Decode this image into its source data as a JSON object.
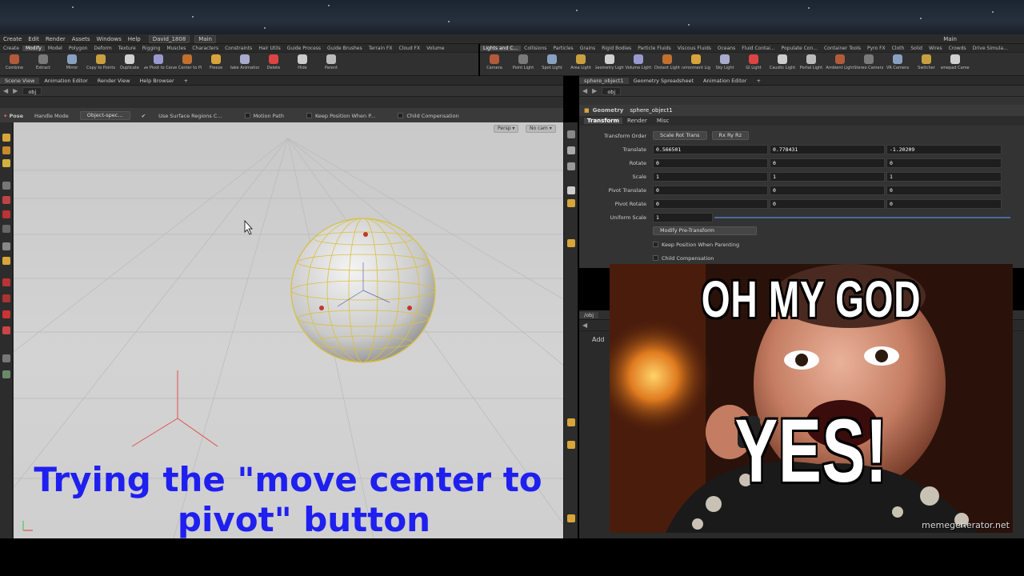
{
  "menubar": {
    "items": [
      "Create",
      "Edit",
      "Render",
      "Assets",
      "Windows",
      "Help"
    ],
    "desktop": "David_1808",
    "context": "Main",
    "right_label": "Main"
  },
  "shelf_left": {
    "tabs": [
      "Create",
      "Modify",
      "Model",
      "Polygon",
      "Deform",
      "Texture",
      "Rigging",
      "Muscles",
      "Characters",
      "Constraints",
      "Hair Utils",
      "Guide Process",
      "Guide Brushes",
      "Terrain FX",
      "Cloud FX",
      "Volume"
    ],
    "tools": [
      "Combine",
      "Extract",
      "Mirror",
      "Copy to Points",
      "Duplicate",
      "Move Pivot to Center",
      "Move Center to Pivot",
      "Freeze",
      "Bake Animation",
      "Delete",
      "Hide",
      "Parent"
    ]
  },
  "shelf_right": {
    "tabs": [
      "Lights and C...",
      "Collisions",
      "Particles",
      "Grains",
      "Rigid Bodies",
      "Particle Fluids",
      "Viscous Fluids",
      "Oceans",
      "Fluid Contai...",
      "Populate Con...",
      "Container Tools",
      "Pyro FX",
      "Cloth",
      "Solid",
      "Wires",
      "Crowds",
      "Drive Simula..."
    ],
    "tools": [
      "Camera",
      "Point Light",
      "Spot Light",
      "Area Light",
      "Geometry Light",
      "Volume Light",
      "Distant Light",
      "Environment Light",
      "Sky Light",
      "GI Light",
      "Caustic Light",
      "Portal Light",
      "Ambient Light",
      "Stereo Camera",
      "VR Camera",
      "Switcher",
      "Gamepad Camera"
    ]
  },
  "left_panetabs": [
    "Scene View",
    "Animation Editor",
    "Render View",
    "Help Browser"
  ],
  "left_path": "obj",
  "opbar": {
    "tool": "Pose",
    "mode": "Handle Mode",
    "space": "Object-spec...",
    "opt1": "Use Surface Regions C...",
    "opt2": "Motion Path",
    "opt3": "Keep Position When P...",
    "opt4": "Child Compensation"
  },
  "viewport": {
    "persp": "Persp ▾",
    "cam": "No cam ▾"
  },
  "caption": {
    "line1": "Trying the \"move center to",
    "line2": "pivot\" button"
  },
  "right_panetabs": [
    "sphere_object1",
    "Geometry Spreadsheet",
    "Animation Editor"
  ],
  "right_path": "obj",
  "node": {
    "type": "Geometry",
    "name": "sphere_object1"
  },
  "param_tabs": [
    "Transform",
    "Render",
    "Misc"
  ],
  "params": {
    "transform_order_label": "Transform Order",
    "transform_order": "Scale Rot Trans",
    "rot_order": "Rx Ry Rz",
    "rows": [
      {
        "label": "Translate",
        "values": [
          "0.566501",
          "0.778431",
          "-1.20209"
        ]
      },
      {
        "label": "Rotate",
        "values": [
          "0",
          "0",
          "0"
        ]
      },
      {
        "label": "Scale",
        "values": [
          "1",
          "1",
          "1"
        ]
      },
      {
        "label": "Pivot Translate",
        "values": [
          "0",
          "0",
          "0"
        ]
      },
      {
        "label": "Pivot Rotate",
        "values": [
          "0",
          "0",
          "0"
        ]
      }
    ],
    "uniform_scale_label": "Uniform Scale",
    "uniform_scale": "1",
    "modify_pre": "Modify Pre-Transform",
    "keep_pos": "Keep Position When Parenting",
    "child_comp": "Child Compensation"
  },
  "network": {
    "path": "/obj",
    "add": "Add"
  },
  "meme": {
    "top": "OH MY GOD",
    "bottom": "YES!",
    "watermark": "memegenerator.net"
  }
}
